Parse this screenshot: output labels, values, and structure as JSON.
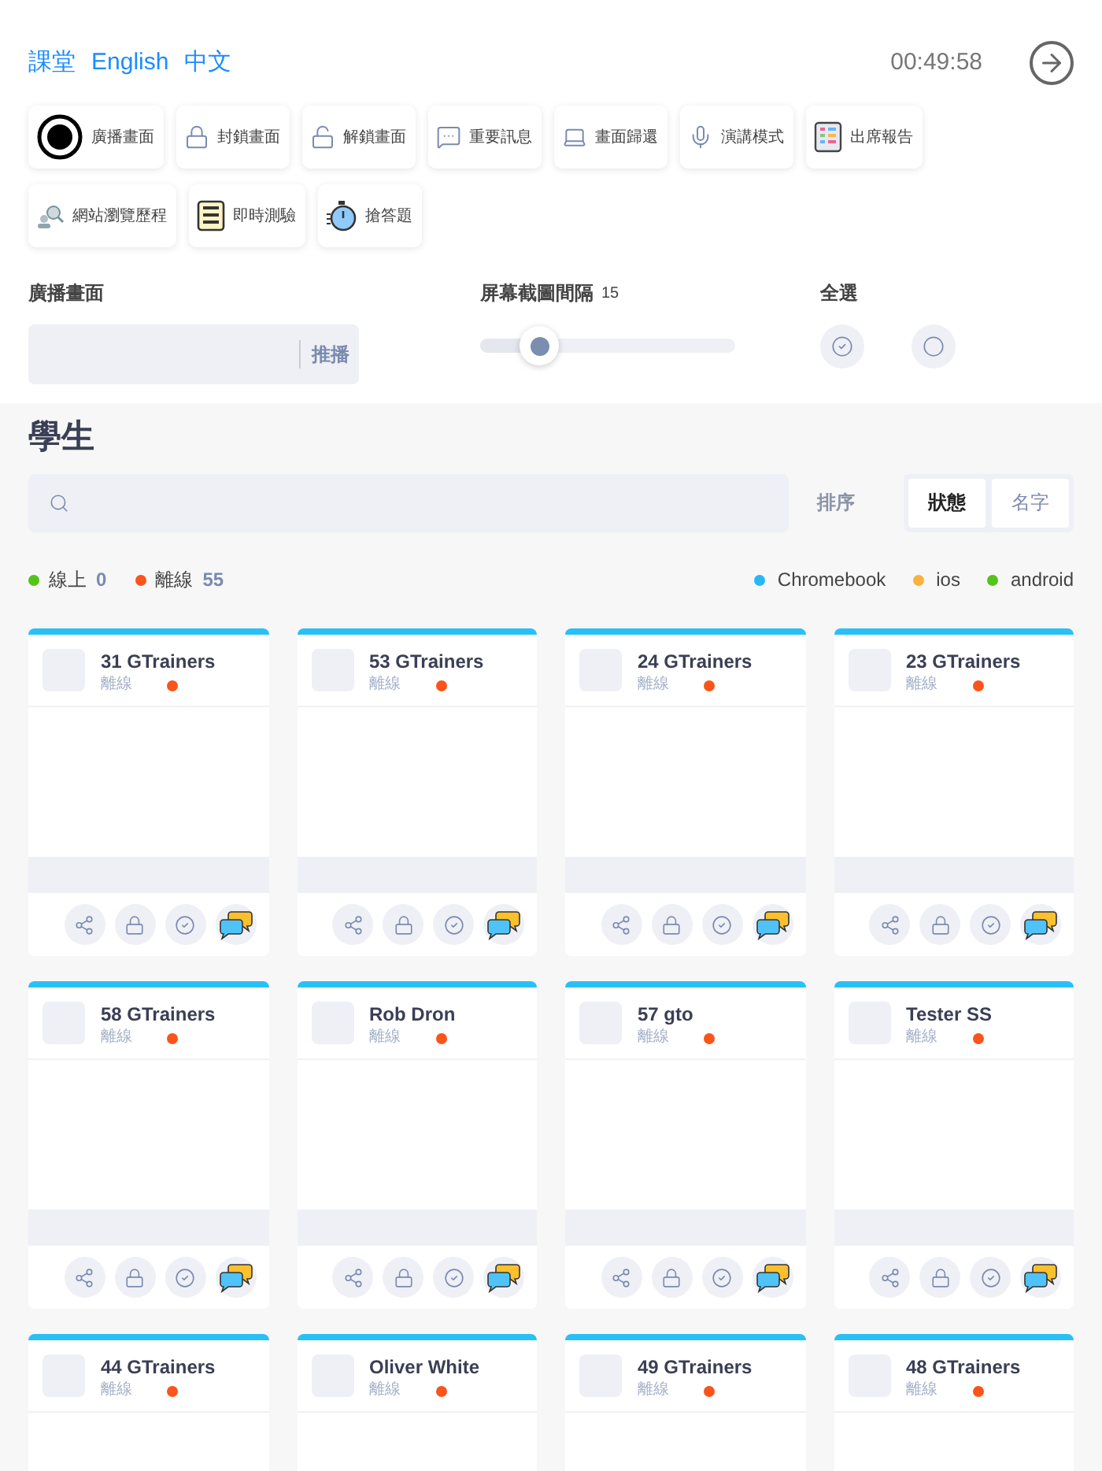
{
  "header": {
    "languages": [
      {
        "label": "課堂"
      },
      {
        "label": "English"
      },
      {
        "label": "中文"
      }
    ],
    "timer": "00:49:58"
  },
  "toolbar": [
    {
      "label": "廣播畫面"
    },
    {
      "label": "封鎖畫面"
    },
    {
      "label": "解鎖畫面"
    },
    {
      "label": "重要訊息"
    },
    {
      "label": "畫面歸還"
    },
    {
      "label": "演講模式"
    },
    {
      "label": "出席報告"
    },
    {
      "label": "網站瀏覽歷程"
    },
    {
      "label": "即時測驗"
    },
    {
      "label": "搶答題"
    }
  ],
  "broadcast": {
    "label": "廣播畫面",
    "button": "推播"
  },
  "interval": {
    "label": "屏幕截圖間隔",
    "value": "15",
    "level": 0.23
  },
  "select_all": {
    "label": "全選"
  },
  "students": {
    "title": "學生",
    "sort_label": "排序",
    "sort_options": [
      {
        "label": "狀態",
        "selected": true
      },
      {
        "label": "名字",
        "selected": false
      }
    ],
    "status_legend": [
      {
        "label": "線上",
        "count": "0",
        "color": "#52c41a"
      },
      {
        "label": "離線",
        "count": "55",
        "color": "#fa541c"
      }
    ],
    "device_legend": [
      {
        "label": "Chromebook",
        "color": "#29b6f6"
      },
      {
        "label": "ios",
        "color": "#fbb13c"
      },
      {
        "label": "android",
        "color": "#52c41a"
      }
    ],
    "cards": [
      {
        "name": "31 GTrainers",
        "status": "離線",
        "color": "#fa541c"
      },
      {
        "name": "53 GTrainers",
        "status": "離線",
        "color": "#fa541c"
      },
      {
        "name": "24 GTrainers",
        "status": "離線",
        "color": "#fa541c"
      },
      {
        "name": "23 GTrainers",
        "status": "離線",
        "color": "#fa541c"
      },
      {
        "name": "58 GTrainers",
        "status": "離線",
        "color": "#fa541c"
      },
      {
        "name": "Rob Dron",
        "status": "離線",
        "color": "#fa541c"
      },
      {
        "name": "57 gto",
        "status": "離線",
        "color": "#fa541c"
      },
      {
        "name": "Tester SS",
        "status": "離線",
        "color": "#fa541c"
      },
      {
        "name": "44 GTrainers",
        "status": "離線",
        "color": "#fa541c"
      },
      {
        "name": "Oliver White",
        "status": "離線",
        "color": "#fa541c"
      },
      {
        "name": "49 GTrainers",
        "status": "離線",
        "color": "#fa541c"
      },
      {
        "name": "48 GTrainers",
        "status": "離線",
        "color": "#fa541c"
      }
    ]
  }
}
